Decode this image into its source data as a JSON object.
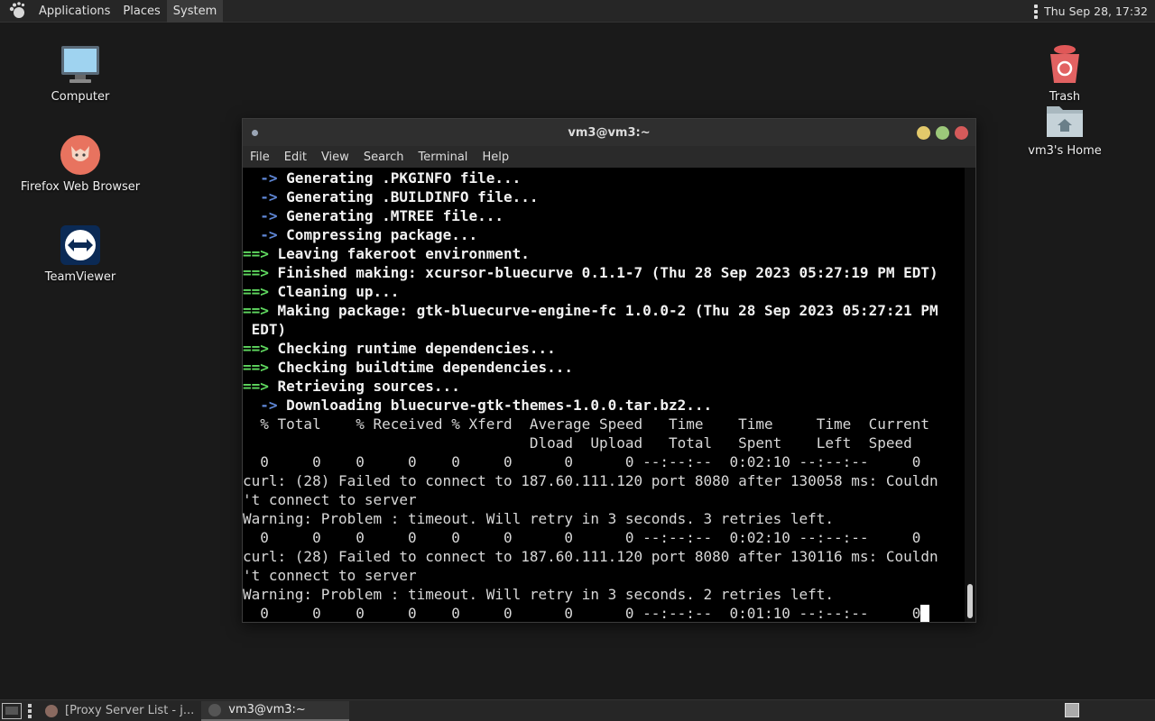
{
  "top_panel": {
    "menus": [
      "Applications",
      "Places",
      "System"
    ],
    "clock": "Thu Sep 28, 17:32"
  },
  "desktop": {
    "icons_left": [
      {
        "label": "Computer"
      },
      {
        "label": "Firefox Web Browser"
      },
      {
        "label": "TeamViewer"
      }
    ],
    "icons_right": [
      {
        "label": "Trash"
      },
      {
        "label": "vm3's Home"
      }
    ]
  },
  "terminal": {
    "title": "vm3@vm3:~",
    "menu": [
      "File",
      "Edit",
      "View",
      "Search",
      "Terminal",
      "Help"
    ],
    "lines": [
      {
        "prefix": "  -> ",
        "kind": "arrow",
        "text": "Generating .PKGINFO file..."
      },
      {
        "prefix": "  -> ",
        "kind": "arrow",
        "text": "Generating .BUILDINFO file..."
      },
      {
        "prefix": "  -> ",
        "kind": "arrow",
        "text": "Generating .MTREE file..."
      },
      {
        "prefix": "  -> ",
        "kind": "arrow",
        "text": "Compressing package..."
      },
      {
        "prefix": "==> ",
        "kind": "main",
        "text": "Leaving fakeroot environment."
      },
      {
        "prefix": "==> ",
        "kind": "main",
        "text": "Finished making: xcursor-bluecurve 0.1.1-7 (Thu 28 Sep 2023 05:27:19 PM EDT)"
      },
      {
        "prefix": "==> ",
        "kind": "main",
        "text": "Cleaning up..."
      },
      {
        "prefix": "==> ",
        "kind": "main",
        "text": "Making package: gtk-bluecurve-engine-fc 1.0.0-2 (Thu 28 Sep 2023 05:27:21 PM"
      },
      {
        "prefix": "",
        "kind": "bold",
        "text": " EDT)"
      },
      {
        "prefix": "==> ",
        "kind": "main",
        "text": "Checking runtime dependencies..."
      },
      {
        "prefix": "==> ",
        "kind": "main",
        "text": "Checking buildtime dependencies..."
      },
      {
        "prefix": "==> ",
        "kind": "main",
        "text": "Retrieving sources..."
      },
      {
        "prefix": "  -> ",
        "kind": "arrow",
        "text": "Downloading bluecurve-gtk-themes-1.0.0.tar.bz2..."
      },
      {
        "prefix": "",
        "kind": "plain",
        "text": "  % Total    % Received % Xferd  Average Speed   Time    Time     Time  Current"
      },
      {
        "prefix": "",
        "kind": "plain",
        "text": "                                 Dload  Upload   Total   Spent    Left  Speed"
      },
      {
        "prefix": "",
        "kind": "plain",
        "text": "  0     0    0     0    0     0      0      0 --:--:--  0:02:10 --:--:--     0"
      },
      {
        "prefix": "",
        "kind": "plain",
        "text": "curl: (28) Failed to connect to 187.60.111.120 port 8080 after 130058 ms: Couldn"
      },
      {
        "prefix": "",
        "kind": "plain",
        "text": "'t connect to server"
      },
      {
        "prefix": "",
        "kind": "plain",
        "text": "Warning: Problem : timeout. Will retry in 3 seconds. 3 retries left."
      },
      {
        "prefix": "",
        "kind": "plain",
        "text": "  0     0    0     0    0     0      0      0 --:--:--  0:02:10 --:--:--     0"
      },
      {
        "prefix": "",
        "kind": "plain",
        "text": "curl: (28) Failed to connect to 187.60.111.120 port 8080 after 130116 ms: Couldn"
      },
      {
        "prefix": "",
        "kind": "plain",
        "text": "'t connect to server"
      },
      {
        "prefix": "",
        "kind": "plain",
        "text": "Warning: Problem : timeout. Will retry in 3 seconds. 2 retries left."
      },
      {
        "prefix": "",
        "kind": "cursor",
        "text": "  0     0    0     0    0     0      0      0 --:--:--  0:01:10 --:--:--     0"
      }
    ]
  },
  "taskbar": {
    "tasks": [
      {
        "label": "[Proxy Server List - j...",
        "active": false
      },
      {
        "label": "vm3@vm3:~",
        "active": true
      }
    ]
  }
}
